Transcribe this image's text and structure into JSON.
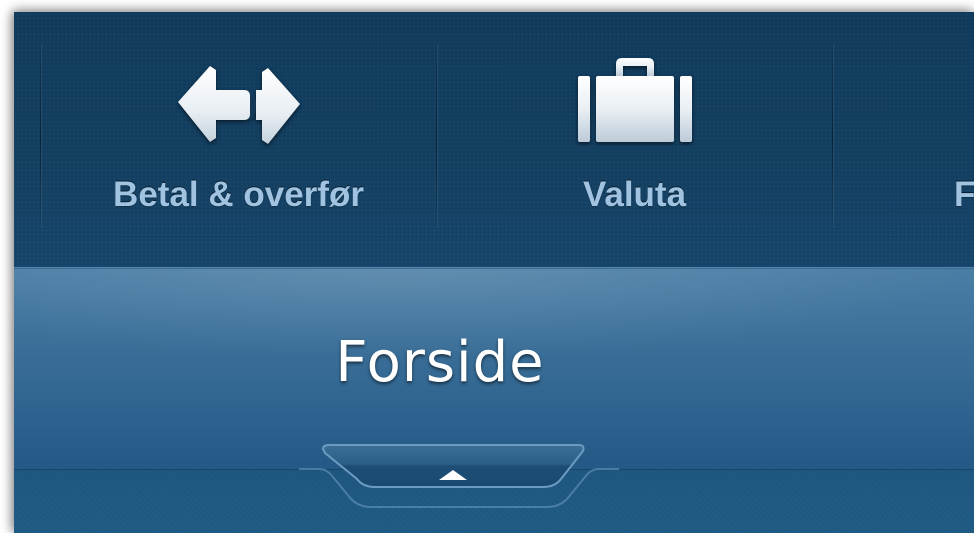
{
  "nav": {
    "items": [
      {
        "label": "Betal & overfør",
        "icon": "transfer-arrows-icon"
      },
      {
        "label": "Valuta",
        "icon": "briefcase-icon"
      },
      {
        "label": "F",
        "icon": ""
      }
    ]
  },
  "header": {
    "title": "Forside"
  },
  "pull_tab": {
    "icon": "caret-up-icon"
  },
  "colors": {
    "nav_background": "#123e60",
    "nav_label": "#9fc3e1",
    "title_bar": "#3e729b",
    "title_text": "#ffffff"
  }
}
